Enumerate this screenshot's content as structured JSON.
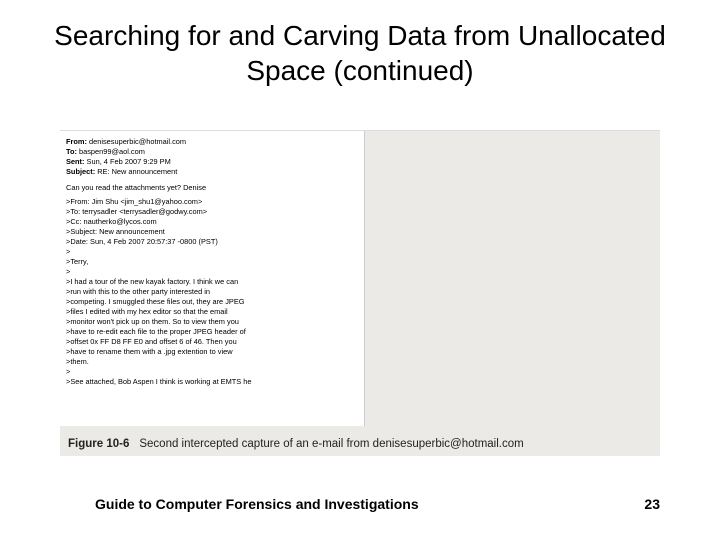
{
  "title": "Searching for and Carving Data from Unallocated Space (continued)",
  "email": {
    "from_label": "From:",
    "from": " denisesuperbic@hotmail.com",
    "to_label": "To:",
    "to": " baspen99@aol.com",
    "sent_label": "Sent:",
    "sent": " Sun, 4 Feb 2007 9:29 PM",
    "subject_label": "Subject:",
    "subject": " RE: New announcement",
    "body": "Can you read the attachments yet? Denise",
    "quoted": [
      ">From: Jim Shu <jim_shu1@yahoo.com>",
      ">To: terrysadler <terrysadler@godwy.com>",
      ">Cc: nautherko@lycos.com",
      ">Subject: New announcement",
      ">Date: Sun, 4 Feb 2007 20:57:37 -0800 (PST)",
      ">",
      ">Terry,",
      ">",
      ">I had a tour of the new kayak factory. I think we can",
      ">run with this to the other party interested in",
      ">competing. I smuggled these files out, they are JPEG",
      ">files I edited with my hex editor so that the email",
      ">monitor won't pick up on them. So to view them you",
      ">have to re-edit each file to the proper JPEG header of",
      ">offset 0x FF D8 FF E0 and offset 6 of 46. Then you",
      ">have to rename them with a .jpg extention to view",
      ">them.",
      ">",
      ">See attached, Bob Aspen I think is working at EMTS he"
    ]
  },
  "caption": {
    "fignum": "Figure 10-6",
    "text": "Second intercepted capture of an e-mail from denisesuperbic@hotmail.com"
  },
  "footer": {
    "left": "Guide to Computer Forensics and Investigations",
    "right": "23"
  }
}
